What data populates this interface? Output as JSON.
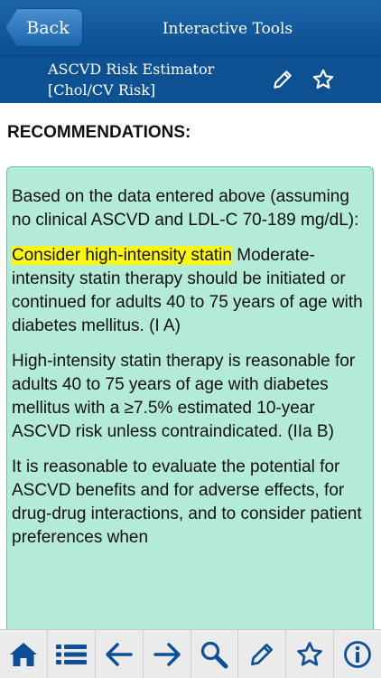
{
  "navbar": {
    "back_label": "Back",
    "title": "Interactive Tools"
  },
  "subbar": {
    "title_line1": "ASCVD Risk Estimator",
    "title_line2": "[Chol/CV Risk]"
  },
  "content": {
    "heading": "RECOMMENDATIONS:",
    "para1": "Based on the data entered above (assuming no clinical ASCVD and LDL-C 70-189 mg/dL):",
    "highlight": "Consider high-intensity statin",
    "para2_rest": " Moderate-intensity statin therapy should be initiated or continued for adults 40 to 75 years of age with diabetes mellitus. (I A)",
    "para3": "High-intensity statin therapy is reasonable for adults 40 to 75 years of age with diabetes mellitus with a ≥7.5% estimated 10-year ASCVD risk unless contraindicated. (IIa B)",
    "para4": "It is reasonable to evaluate the potential for ASCVD benefits and for adverse effects, for drug-drug interactions, and to consider patient preferences when"
  },
  "tabbar": {
    "icons": [
      "home-icon",
      "list-icon",
      "arrow-left-icon",
      "arrow-right-icon",
      "search-icon",
      "pencil-icon",
      "star-icon",
      "info-icon"
    ]
  },
  "colors": {
    "navbar": "#0d5193",
    "box_bg": "#b3ebd6",
    "highlight": "#fbf70f",
    "icon": "#0d4f96"
  }
}
